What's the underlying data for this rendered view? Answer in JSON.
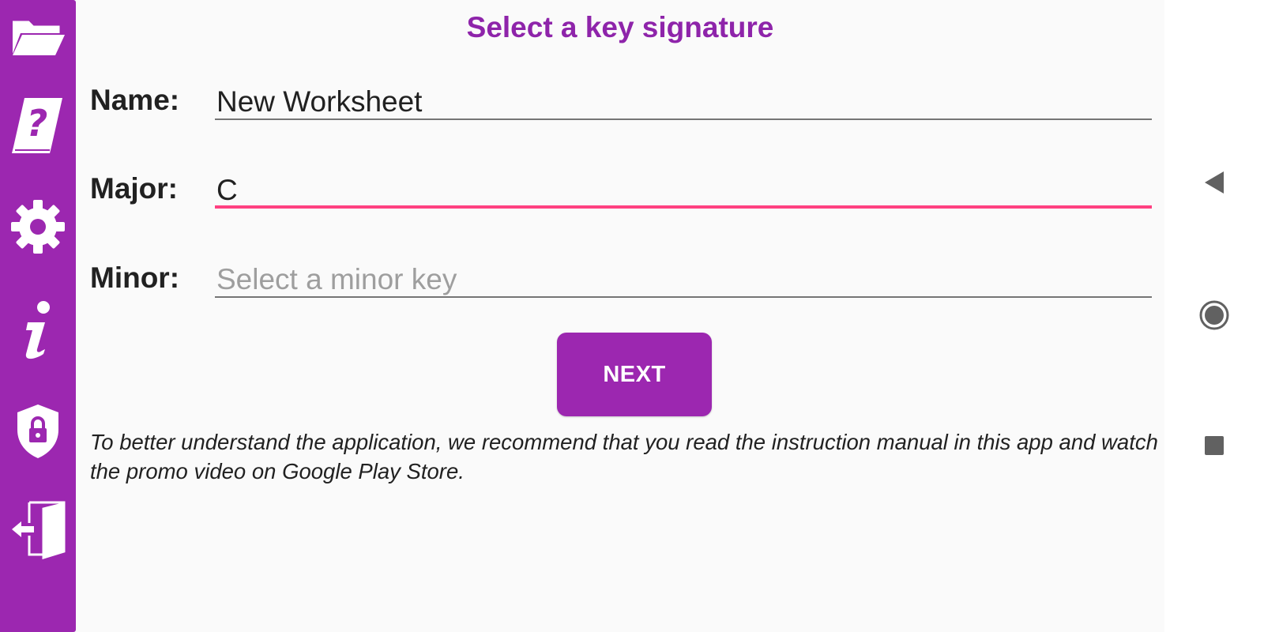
{
  "sidebar": {
    "items": [
      {
        "icon": "folder-open-icon"
      },
      {
        "icon": "help-book-icon"
      },
      {
        "icon": "gear-icon"
      },
      {
        "icon": "info-icon"
      },
      {
        "icon": "shield-lock-icon"
      },
      {
        "icon": "exit-door-icon"
      }
    ],
    "color": "#9c27b0"
  },
  "header": {
    "title": "Select a key signature",
    "title_color": "#8e24aa"
  },
  "form": {
    "name": {
      "label": "Name:",
      "value": "New Worksheet"
    },
    "major": {
      "label": "Major:",
      "value": "C",
      "focused": true
    },
    "minor": {
      "label": "Minor:",
      "value": "",
      "placeholder": "Select a minor key"
    },
    "accent_color": "#ff4081"
  },
  "actions": {
    "next_label": "NEXT"
  },
  "note": {
    "text": "To better understand the application, we recommend that you read the instruction manual in this app and watch the promo video on Google Play Store."
  },
  "system_nav": {
    "items": [
      "back-icon",
      "home-icon",
      "recents-icon"
    ]
  }
}
